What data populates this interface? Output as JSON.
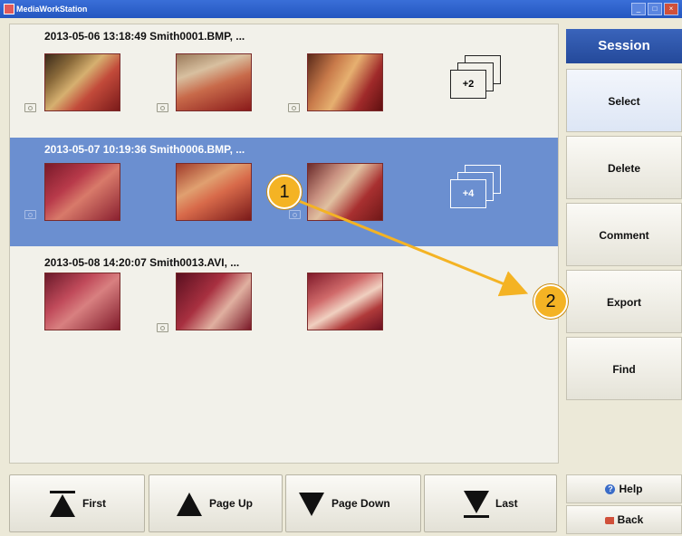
{
  "window": {
    "title": "MediaWorkStation"
  },
  "sessions": [
    {
      "header": "2013-05-06 13:18:49  Smith0001.BMP, ...",
      "more_count": "+2",
      "selected": false
    },
    {
      "header": "2013-05-07 10:19:36  Smith0006.BMP, ...",
      "more_count": "+4",
      "selected": true
    },
    {
      "header": "2013-05-08 14:20:07  Smith0013.AVI, ...",
      "more_count": "",
      "selected": false
    }
  ],
  "side_panel": {
    "title": "Session",
    "buttons": [
      "Select",
      "Delete",
      "Comment",
      "Export",
      "Find"
    ],
    "help": "Help",
    "back": "Back"
  },
  "nav": {
    "first": "First",
    "page_up": "Page Up",
    "page_down": "Page Down",
    "last": "Last"
  },
  "annotations": {
    "callout_1": "1",
    "callout_2": "2"
  },
  "colors": {
    "selection": "#6b8fd0",
    "session_header": "#2d56ab",
    "callout": "#f4b324",
    "arrow": "#f4b324"
  }
}
